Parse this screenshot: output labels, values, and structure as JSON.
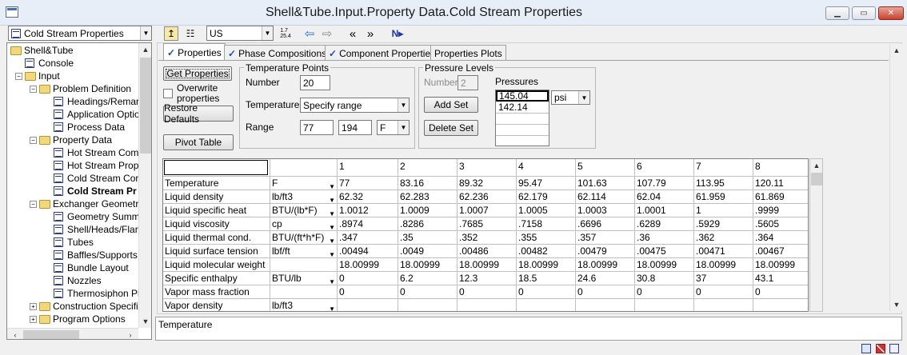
{
  "window": {
    "title": "Shell&Tube.Input.Property Data.Cold Stream Properties"
  },
  "toolbar": {
    "form_select": "Cold Stream Properties",
    "units": "US"
  },
  "tree": [
    {
      "label": "Shell&Tube",
      "kind": "folder",
      "level": 0
    },
    {
      "label": "Console",
      "kind": "form",
      "level": 1
    },
    {
      "label": "Input",
      "kind": "folder",
      "level": 1
    },
    {
      "label": "Problem Definition",
      "kind": "folder",
      "level": 2
    },
    {
      "label": "Headings/Remar",
      "kind": "form",
      "level": 3
    },
    {
      "label": "Application Optio",
      "kind": "form",
      "level": 3
    },
    {
      "label": "Process Data",
      "kind": "form",
      "level": 3
    },
    {
      "label": "Property Data",
      "kind": "folder",
      "level": 2
    },
    {
      "label": "Hot Stream Comp",
      "kind": "form",
      "level": 3
    },
    {
      "label": "Hot Stream Prope",
      "kind": "form",
      "level": 3
    },
    {
      "label": "Cold Stream Com",
      "kind": "form",
      "level": 3
    },
    {
      "label": "Cold Stream Pr",
      "kind": "form",
      "level": 3,
      "bold": true
    },
    {
      "label": "Exchanger Geometry",
      "kind": "folder",
      "level": 2
    },
    {
      "label": "Geometry Summa",
      "kind": "form",
      "level": 3
    },
    {
      "label": "Shell/Heads/Flar",
      "kind": "form",
      "level": 3
    },
    {
      "label": "Tubes",
      "kind": "form",
      "level": 3
    },
    {
      "label": "Baffles/Supports",
      "kind": "form",
      "level": 3
    },
    {
      "label": "Bundle Layout",
      "kind": "form",
      "level": 3
    },
    {
      "label": "Nozzles",
      "kind": "form",
      "level": 3
    },
    {
      "label": "Thermosiphon Pip",
      "kind": "form",
      "level": 3
    },
    {
      "label": "Construction Specific",
      "kind": "folder",
      "level": 2
    },
    {
      "label": "Program Options",
      "kind": "folder",
      "level": 2
    }
  ],
  "tabs": [
    "Properties",
    "Phase Compositions",
    "Component Properties",
    "Properties Plots"
  ],
  "buttons": {
    "get_properties": "Get Properties",
    "overwrite": "Overwrite properties",
    "restore": "Restore Defaults",
    "pivot": "Pivot Table",
    "add_set": "Add Set",
    "delete_set": "Delete Set"
  },
  "temp_points": {
    "group": "Temperature Points",
    "number_label": "Number",
    "number": "20",
    "temps_label": "Temperatures",
    "temps_value": "Specify range",
    "range_label": "Range",
    "range_from": "77",
    "range_to": "194",
    "range_unit": "F"
  },
  "pressure": {
    "group": "Pressure Levels",
    "number_label": "Number",
    "number": "2",
    "pressures_label": "Pressures",
    "values": [
      "145.04",
      "142.14"
    ],
    "unit": "psi"
  },
  "grid": {
    "columns": [
      "1",
      "2",
      "3",
      "4",
      "5",
      "6",
      "7",
      "8"
    ],
    "rows": [
      {
        "name": "Temperature",
        "unit": "F",
        "values": [
          "77",
          "83.16",
          "89.32",
          "95.47",
          "101.63",
          "107.79",
          "113.95",
          "120.11"
        ]
      },
      {
        "name": "Liquid density",
        "unit": "lb/ft3",
        "values": [
          "62.32",
          "62.283",
          "62.236",
          "62.179",
          "62.114",
          "62.04",
          "61.959",
          "61.869"
        ]
      },
      {
        "name": "Liquid specific heat",
        "unit": "BTU/(lb*F)",
        "values": [
          "1.0012",
          "1.0009",
          "1.0007",
          "1.0005",
          "1.0003",
          "1.0001",
          "1",
          ".9999"
        ]
      },
      {
        "name": "Liquid viscosity",
        "unit": "cp",
        "values": [
          ".8974",
          ".8286",
          ".7685",
          ".7158",
          ".6696",
          ".6289",
          ".5929",
          ".5605"
        ]
      },
      {
        "name": "Liquid thermal cond.",
        "unit": "BTU/(ft*h*F)",
        "values": [
          ".347",
          ".35",
          ".352",
          ".355",
          ".357",
          ".36",
          ".362",
          ".364"
        ]
      },
      {
        "name": "Liquid surface tension",
        "unit": "lbf/ft",
        "values": [
          ".00494",
          ".0049",
          ".00486",
          ".00482",
          ".00479",
          ".00475",
          ".00471",
          ".00467"
        ]
      },
      {
        "name": "Liquid molecular weight",
        "unit": "",
        "values": [
          "18.00999",
          "18.00999",
          "18.00999",
          "18.00999",
          "18.00999",
          "18.00999",
          "18.00999",
          "18.00999"
        ]
      },
      {
        "name": "Specific enthalpy",
        "unit": "BTU/lb",
        "values": [
          "0",
          "6.2",
          "12.3",
          "18.5",
          "24.6",
          "30.8",
          "37",
          "43.1"
        ]
      },
      {
        "name": "Vapor mass fraction",
        "unit": "",
        "values": [
          "0",
          "0",
          "0",
          "0",
          "0",
          "0",
          "0",
          "0"
        ]
      },
      {
        "name": "Vapor density",
        "unit": "lb/ft3",
        "values": [
          "",
          "",
          "",
          "",
          "",
          "",
          "",
          ""
        ]
      }
    ]
  },
  "description": "Temperature"
}
